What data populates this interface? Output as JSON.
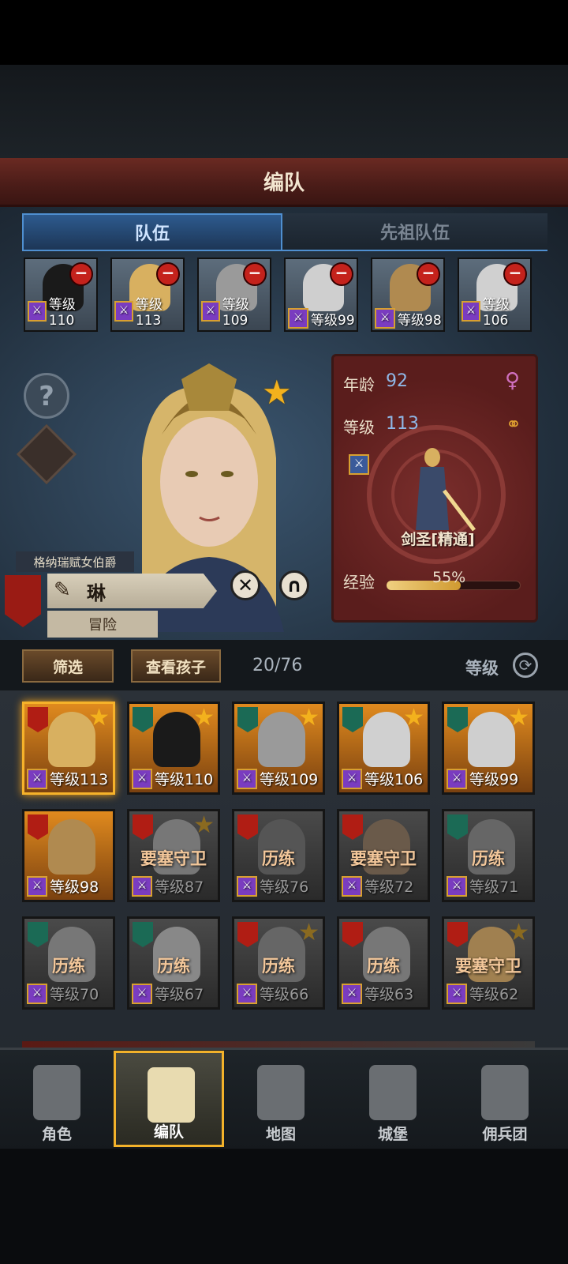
{
  "title": "编队",
  "tabs": [
    "队伍",
    "先祖队伍"
  ],
  "team": [
    {
      "level": "等级110",
      "face": "#1a1a1a"
    },
    {
      "level": "等级113",
      "face": "#d8b060"
    },
    {
      "level": "等级109",
      "face": "#9a9a9a"
    },
    {
      "level": "等级99",
      "face": "#cfcfcf"
    },
    {
      "level": "等级98",
      "face": "#b08a50"
    },
    {
      "level": "等级106",
      "face": "#d0d0d0"
    }
  ],
  "hero": {
    "title": "格纳瑞赋女伯爵",
    "name": "琳",
    "status": "冒险",
    "age_label": "年龄",
    "age": "92",
    "level_label": "等级",
    "level": "113",
    "class": "剑圣[精通]",
    "exp_label": "经验",
    "exp": "55%",
    "exp_fraction": 0.55
  },
  "filter": {
    "filter_btn": "筛选",
    "children_btn": "查看孩子",
    "count": "20/76",
    "sort": "等级"
  },
  "roster": [
    {
      "level": "等级113",
      "status": "",
      "dim": false,
      "sel": true,
      "shield": "red",
      "star": true,
      "face": "#d8b060"
    },
    {
      "level": "等级110",
      "status": "",
      "dim": false,
      "sel": false,
      "shield": "green",
      "star": true,
      "face": "#1a1a1a"
    },
    {
      "level": "等级109",
      "status": "",
      "dim": false,
      "sel": false,
      "shield": "green",
      "star": true,
      "face": "#9a9a9a"
    },
    {
      "level": "等级106",
      "status": "",
      "dim": false,
      "sel": false,
      "shield": "green",
      "star": true,
      "face": "#d0d0d0"
    },
    {
      "level": "等级99",
      "status": "",
      "dim": false,
      "sel": false,
      "shield": "green",
      "star": true,
      "face": "#cfcfcf"
    },
    {
      "level": "等级98",
      "status": "",
      "dim": false,
      "sel": false,
      "shield": "red",
      "star": false,
      "face": "#b08a50"
    },
    {
      "level": "等级87",
      "status": "要塞守卫",
      "dim": true,
      "sel": false,
      "shield": "red",
      "star": true,
      "face": "#777"
    },
    {
      "level": "等级76",
      "status": "历练",
      "dim": true,
      "sel": false,
      "shield": "red",
      "star": false,
      "face": "#555"
    },
    {
      "level": "等级72",
      "status": "要塞守卫",
      "dim": true,
      "sel": false,
      "shield": "red",
      "star": false,
      "face": "#6a5a4a"
    },
    {
      "level": "等级71",
      "status": "历练",
      "dim": true,
      "sel": false,
      "shield": "green",
      "star": false,
      "face": "#666"
    },
    {
      "level": "等级70",
      "status": "历练",
      "dim": true,
      "sel": false,
      "shield": "green",
      "star": false,
      "face": "#777"
    },
    {
      "level": "等级67",
      "status": "历练",
      "dim": true,
      "sel": false,
      "shield": "green",
      "star": false,
      "face": "#888"
    },
    {
      "level": "等级66",
      "status": "历练",
      "dim": true,
      "sel": false,
      "shield": "red",
      "star": true,
      "face": "#666"
    },
    {
      "level": "等级63",
      "status": "历练",
      "dim": true,
      "sel": false,
      "shield": "red",
      "star": false,
      "face": "#777"
    },
    {
      "level": "等级62",
      "status": "要塞守卫",
      "dim": true,
      "sel": false,
      "shield": "red",
      "star": true,
      "face": "#a08050"
    }
  ],
  "nav": [
    {
      "label": "角色",
      "icon": "knight-icon"
    },
    {
      "label": "编队",
      "icon": "helmet-icon"
    },
    {
      "label": "地图",
      "icon": "compass-icon"
    },
    {
      "label": "城堡",
      "icon": "castle-icon"
    },
    {
      "label": "佣兵团",
      "icon": "mercenary-icon"
    }
  ],
  "colors": {
    "accent": "#f3b22a",
    "tab_active": "#2d5a8e",
    "panel": "#6a2624"
  }
}
